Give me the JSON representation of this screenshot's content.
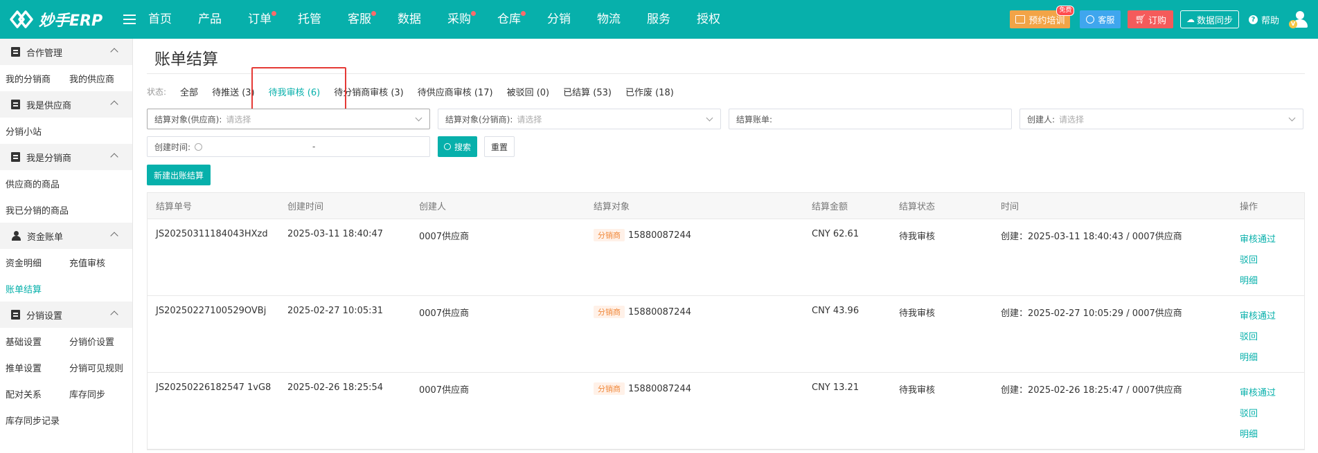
{
  "app": {
    "logo_text": "妙手ERP"
  },
  "nav": [
    {
      "label": "首页",
      "dot": false
    },
    {
      "label": "产品",
      "dot": false
    },
    {
      "label": "订单",
      "dot": true
    },
    {
      "label": "托管",
      "dot": false
    },
    {
      "label": "客服",
      "dot": true
    },
    {
      "label": "数据",
      "dot": false
    },
    {
      "label": "采购",
      "dot": true
    },
    {
      "label": "仓库",
      "dot": true
    },
    {
      "label": "分销",
      "dot": false
    },
    {
      "label": "物流",
      "dot": false
    },
    {
      "label": "服务",
      "dot": false
    },
    {
      "label": "授权",
      "dot": false
    }
  ],
  "topbar": {
    "training_label": "预约培训",
    "training_badge": "免费",
    "kefu_label": "客服",
    "order_label": "订购",
    "sync_label": "数据同步",
    "help_label": "帮助"
  },
  "sidebar": {
    "groups": [
      {
        "label": "合作管理",
        "links": [
          "我的分销商",
          "我的供应商"
        ]
      },
      {
        "label": "我是供应商",
        "links": [
          "分销小站"
        ]
      },
      {
        "label": "我是分销商",
        "links": [
          "供应商的商品",
          "我已分销的商品"
        ]
      },
      {
        "label": "资金账单",
        "links": [
          "资金明细",
          "充值审核",
          "账单结算"
        ]
      },
      {
        "label": "分销设置",
        "links": [
          "基础设置",
          "分销价设置",
          "推单设置",
          "分销可见规则",
          "配对关系",
          "库存同步",
          "库存同步记录"
        ]
      }
    ]
  },
  "page": {
    "title": "账单结算",
    "status_label": "状态:",
    "statuses": [
      "全部",
      "待推送 (3)",
      "待我审核 (6)",
      "待分销商审核 (3)",
      "待供应商审核 (17)",
      "被驳回 (0)",
      "已结算 (53)",
      "已作废 (18)"
    ],
    "filters": {
      "supplier_label": "结算对象(供应商):",
      "supplier_placeholder": "请选择",
      "distributor_label": "结算对象(分销商):",
      "distributor_placeholder": "请选择",
      "bill_label": "结算账单:",
      "creator_label": "创建人:",
      "creator_placeholder": "请选择",
      "time_label": "创建时间:",
      "time_sep": "-",
      "search_label": "搜索",
      "reset_label": "重置"
    },
    "new_button": "新建出账结算"
  },
  "table": {
    "headers": [
      "结算单号",
      "创建时间",
      "创建人",
      "结算对象",
      "结算金额",
      "结算状态",
      "时间",
      "操作"
    ],
    "rows": [
      {
        "no": "JS20250311184043HXzd",
        "created": "2025-03-11 18:40:47",
        "creator": "0007供应商",
        "tag": "分销商",
        "target": "15880087244",
        "amount": "CNY 62.61",
        "status": "待我审核",
        "time": "创建：2025-03-11 18:40:43 / 0007供应商",
        "ops": [
          "审核通过",
          "驳回",
          "明细"
        ]
      },
      {
        "no": "JS20250227100529OVBj",
        "created": "2025-02-27 10:05:31",
        "creator": "0007供应商",
        "tag": "分销商",
        "target": "15880087244",
        "amount": "CNY 43.96",
        "status": "待我审核",
        "time": "创建：2025-02-27 10:05:29 / 0007供应商",
        "ops": [
          "审核通过",
          "驳回",
          "明细"
        ]
      },
      {
        "no": "JS20250226182547 1vG8",
        "created": "2025-02-26 18:25:54",
        "creator": "0007供应商",
        "tag": "分销商",
        "target": "15880087244",
        "amount": "CNY 13.21",
        "status": "待我审核",
        "time": "创建：2025-02-26 18:25:47 / 0007供应商",
        "ops": [
          "审核通过",
          "驳回",
          "明细"
        ]
      }
    ]
  }
}
